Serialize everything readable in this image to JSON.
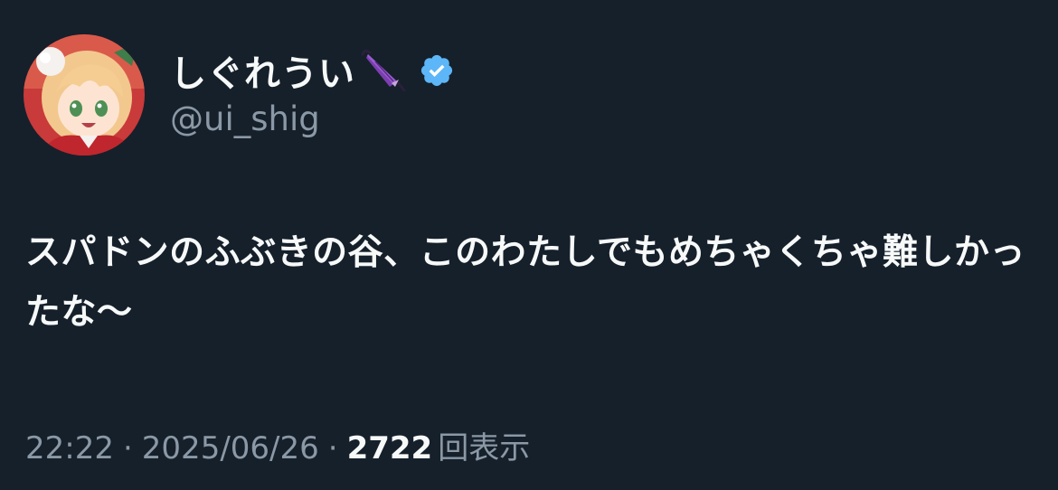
{
  "user": {
    "display_name": "しぐれうい",
    "handle": "@ui_shig",
    "avatar_icon": "avatar-illustration",
    "name_emoji_icon": "umbrella-icon",
    "verified_icon": "verified-badge-icon",
    "verified_color": "#5db6f7"
  },
  "tweet": {
    "text": "スパドンのふぶきの谷、このわたしでもめちゃくちゃ難しかったな〜"
  },
  "meta": {
    "time": "22:22",
    "separator": "·",
    "date": "2025/06/26",
    "views_count": "2722",
    "views_label": "回表示"
  },
  "colors": {
    "background": "#15202b",
    "primary_text": "#f7f9f9",
    "secondary_text": "#8b98a5"
  }
}
